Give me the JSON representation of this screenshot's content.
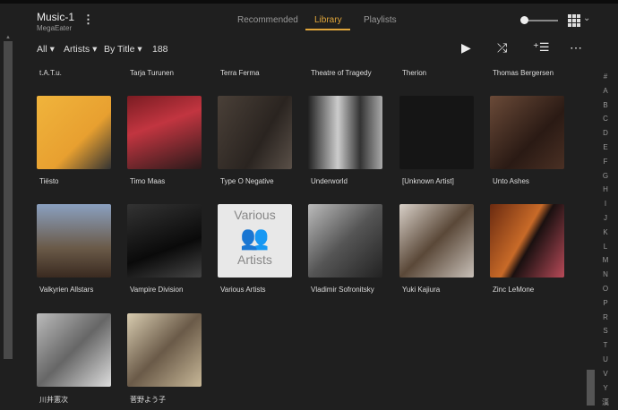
{
  "app": {
    "title": "Music-1",
    "subtitle": "MegaEater"
  },
  "tabs": [
    {
      "label": "Recommended"
    },
    {
      "label": "Library",
      "active": true
    },
    {
      "label": "Playlists"
    }
  ],
  "filters": {
    "scope": "All",
    "category": "Artists",
    "sort": "By Title",
    "count": "188"
  },
  "accent": "#e0a53a",
  "top_row_names": [
    "t.A.T.u.",
    "Tarja Turunen",
    "Terra Ferma",
    "Theatre of Tragedy",
    "Therion",
    "Thomas Bergersen"
  ],
  "artists": [
    {
      "name": "Tiësto",
      "color": "linear-gradient(135deg,#f0b43c,#e8a030 60%,#333)"
    },
    {
      "name": "Timo Maas",
      "color": "linear-gradient(160deg,#7a1c22,#c23540 40%,#2a1a1a)"
    },
    {
      "name": "Type O Negative",
      "color": "linear-gradient(120deg,#4a4038,#2a2420 60%,#5a5048)"
    },
    {
      "name": "Underworld",
      "color": "linear-gradient(90deg,#222,#ccc 40%,#333 70%,#aaa)"
    },
    {
      "name": "[Unknown Artist]",
      "color": "#151515"
    },
    {
      "name": "Unto Ashes",
      "color": "linear-gradient(135deg,#6a4a38,#2a1a14 60%,#4a3024)"
    },
    {
      "name": "Valkyrien Allstars",
      "color": "linear-gradient(180deg,#8aa0c0,#6a5a48 60%,#3a2a20)"
    },
    {
      "name": "Vampire Division",
      "color": "linear-gradient(160deg,#333,#0a0a0a 60%,#444)"
    },
    {
      "name": "Various Artists",
      "color": "#e8e8e8",
      "various": [
        "Various",
        "Artists"
      ]
    },
    {
      "name": "Vladimir Sofronitsky",
      "color": "linear-gradient(135deg,#bbb,#555 50%,#222)"
    },
    {
      "name": "Yuki Kajiura",
      "color": "linear-gradient(135deg,#d8d0c8,#5a4838 50%,#c8c0b8)"
    },
    {
      "name": "Zinc LeMone",
      "color": "linear-gradient(120deg,#6a2a10,#c86a28 45%,#1a1010 55%,#b84a58)"
    },
    {
      "name": "川井憲次",
      "color": "linear-gradient(135deg,#bbb,#666 50%,#ddd)"
    },
    {
      "name": "菅野よう子",
      "color": "linear-gradient(135deg,#d8ccb0,#6a5a48 50%,#c8b898)"
    }
  ],
  "alphabet": [
    "#",
    "A",
    "B",
    "C",
    "D",
    "E",
    "F",
    "G",
    "H",
    "I",
    "J",
    "K",
    "L",
    "M",
    "N",
    "O",
    "P",
    "R",
    "S",
    "T",
    "U",
    "V",
    "Y",
    "漢"
  ]
}
